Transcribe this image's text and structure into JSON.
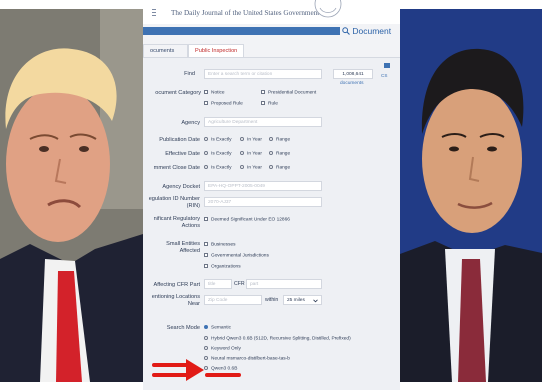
{
  "site": {
    "tagline": "The Daily Journal of the United States Government",
    "search_link": "Document"
  },
  "tabs": [
    {
      "label": "ocuments"
    },
    {
      "label": "Public Inspection"
    }
  ],
  "form": {
    "find_label": "Find",
    "find_placeholder": "Enter a search term or citation",
    "result_count": "1,008,641",
    "result_unit": "documents",
    "side_link": "CS",
    "doc_category_label": "ocument Category",
    "doc_category_options": [
      "Notice",
      "Presidential Document",
      "Proposed Rule",
      "Rule"
    ],
    "agency_label": "Agency",
    "agency_placeholder": "Agriculture Department",
    "publication_date_label": "Publication Date",
    "effective_date_label": "Effective Date",
    "comment_close_label": "mment Close Date",
    "date_options": [
      "Is Exactly",
      "In Year",
      "Range"
    ],
    "agency_docket_label": "Agency Docket",
    "agency_docket_placeholder": "EPA-HQ-OPPT-2005-0049",
    "rin_label": "egulation ID Number\n(RIN)",
    "rin_placeholder": "2070-AJ37",
    "significant_label": "nificant Regulatory\nActions",
    "significant_option": "Deemed Significant Under EO 12866",
    "small_entities_label": "Small Entities\nAffected",
    "small_entities_options": [
      "Businesses",
      "Governmental Jurisdictions",
      "Organizations"
    ],
    "cfr_label": "Affecting CFR Part",
    "cfr_title_placeholder": "title",
    "cfr_mid": "CFR",
    "cfr_part_placeholder": "part",
    "locations_label": "entioning Locations\nNear",
    "zip_placeholder": "Zip Code",
    "within": "within",
    "miles": "25 miles",
    "search_mode_label": "Search Mode",
    "search_mode_options": [
      "Semantic",
      "Hybrid Qwen3 0.6B (512D, Recursive Splitting, Distilled, Prefixed)",
      "Keyword Only",
      "Neural msmarco-distilbert-base-tas-b",
      "Qwen3 0.6B"
    ]
  },
  "colors": {
    "accent": "#3e72b3",
    "annotation": "#e11b16",
    "tab_active": "#c02a2a"
  }
}
